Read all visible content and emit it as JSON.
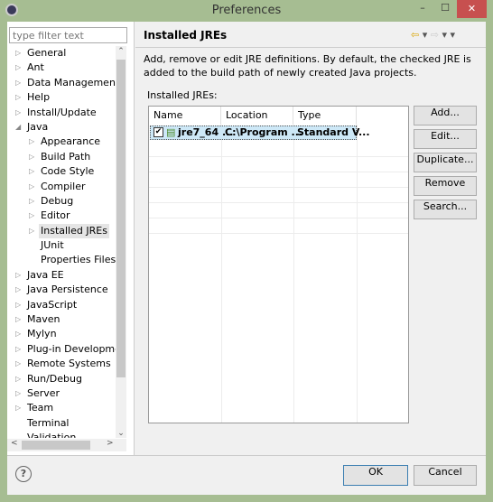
{
  "window": {
    "title": "Preferences",
    "minimize": "–",
    "maximize": "☐",
    "close": "✕"
  },
  "sidebar": {
    "filter_placeholder": "type filter text",
    "items": [
      {
        "label": "General",
        "level": 0,
        "arrow": "▷"
      },
      {
        "label": "Ant",
        "level": 0,
        "arrow": "▷"
      },
      {
        "label": "Data Management",
        "level": 0,
        "arrow": "▷"
      },
      {
        "label": "Help",
        "level": 0,
        "arrow": "▷"
      },
      {
        "label": "Install/Update",
        "level": 0,
        "arrow": "▷"
      },
      {
        "label": "Java",
        "level": 0,
        "arrow": "◢"
      },
      {
        "label": "Appearance",
        "level": 1,
        "arrow": "▷"
      },
      {
        "label": "Build Path",
        "level": 1,
        "arrow": "▷"
      },
      {
        "label": "Code Style",
        "level": 1,
        "arrow": "▷"
      },
      {
        "label": "Compiler",
        "level": 1,
        "arrow": "▷"
      },
      {
        "label": "Debug",
        "level": 1,
        "arrow": "▷"
      },
      {
        "label": "Editor",
        "level": 1,
        "arrow": "▷"
      },
      {
        "label": "Installed JREs",
        "level": 1,
        "arrow": "▷",
        "selected": true
      },
      {
        "label": "JUnit",
        "level": 1,
        "arrow": ""
      },
      {
        "label": "Properties Files Editor",
        "level": 1,
        "arrow": ""
      },
      {
        "label": "Java EE",
        "level": 0,
        "arrow": "▷"
      },
      {
        "label": "Java Persistence",
        "level": 0,
        "arrow": "▷"
      },
      {
        "label": "JavaScript",
        "level": 0,
        "arrow": "▷"
      },
      {
        "label": "Maven",
        "level": 0,
        "arrow": "▷"
      },
      {
        "label": "Mylyn",
        "level": 0,
        "arrow": "▷"
      },
      {
        "label": "Plug-in Development",
        "level": 0,
        "arrow": "▷"
      },
      {
        "label": "Remote Systems",
        "level": 0,
        "arrow": "▷"
      },
      {
        "label": "Run/Debug",
        "level": 0,
        "arrow": "▷"
      },
      {
        "label": "Server",
        "level": 0,
        "arrow": "▷"
      },
      {
        "label": "Team",
        "level": 0,
        "arrow": "▷"
      },
      {
        "label": "Terminal",
        "level": 0,
        "arrow": ""
      },
      {
        "label": "Validation",
        "level": 0,
        "arrow": ""
      }
    ]
  },
  "page": {
    "title": "Installed JREs",
    "nav": "⇦ ▾ ⇨ ▾ ▾",
    "description": "Add, remove or edit JRE definitions. By default, the checked JRE is added to the build path of newly created Java projects.",
    "table_label": "Installed JREs:",
    "columns": [
      "Name",
      "Location",
      "Type"
    ],
    "rows": [
      {
        "checked": true,
        "name": "jre7_64 ...",
        "location": "C:\\Program ...",
        "type": "Standard V..."
      }
    ],
    "buttons": {
      "add": "Add...",
      "edit": "Edit...",
      "duplicate": "Duplicate...",
      "remove": "Remove",
      "search": "Search..."
    }
  },
  "footer": {
    "help": "?",
    "ok": "OK",
    "cancel": "Cancel"
  }
}
